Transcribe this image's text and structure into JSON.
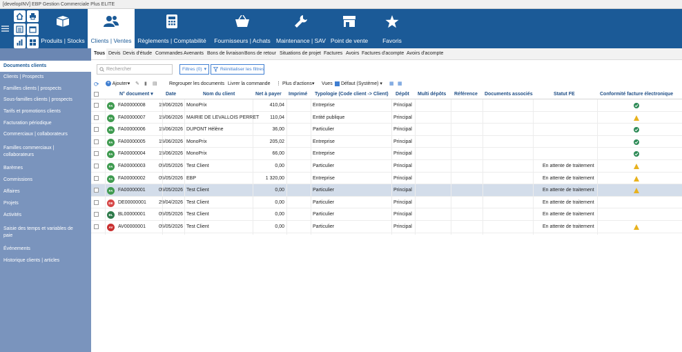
{
  "window_title": "[developINV] EBP Gestion Commerciale Plus ELITE",
  "ribbon": {
    "tabs": [
      {
        "label": "Produits | Stocks",
        "icon": "box-icon"
      },
      {
        "label": "Clients | Ventes",
        "icon": "users-icon",
        "active": true
      },
      {
        "label": "Règlements | Comptabilité",
        "icon": "calculator-icon"
      },
      {
        "label": "Fournisseurs | Achats",
        "icon": "basket-icon"
      },
      {
        "label": "Maintenance | SAV",
        "icon": "wrench-icon"
      },
      {
        "label": "Point de vente",
        "icon": "store-icon"
      },
      {
        "label": "Favoris",
        "icon": "star-icon"
      }
    ]
  },
  "subtabs": [
    "Tous",
    "Devis",
    "Devis d'étude",
    "Commandes",
    "Avenants",
    "Bons de livraison",
    "Bons de retour",
    "Situations de projet",
    "Factures",
    "Avoirs",
    "Factures d'acompte",
    "Avoirs d'acompte"
  ],
  "sidebar": {
    "items": [
      "Documents clients",
      "Clients | Prospects",
      "Familles clients | prospects",
      "Sous-familles clients | prospects",
      "Tarifs et promotions clients",
      "Facturation périodique",
      "Commerciaux | collaborateurs",
      "Familles commerciaux | collaborateurs",
      "Barèmes",
      "Commissions",
      "Affaires",
      "Projets",
      "Activités",
      "Saisie des temps et variables de paie",
      "Événements",
      "Historique clients | articles"
    ]
  },
  "filters": {
    "search_placeholder": "Rechercher",
    "filters_label": "Filtres (0)",
    "reset_label": "Réinitialiser les filtres"
  },
  "toolbar": {
    "add": "Ajouter",
    "group": "Regrouper les documents",
    "deliver": "Livrer la commande",
    "more": "Plus d'actions",
    "views": "Vues",
    "view_value": "Défaut (Système)"
  },
  "table": {
    "columns": [
      "N° document",
      "Date",
      "Nom du client",
      "Net à payer",
      "Imprimé",
      "Typologie (Code client -> Client)",
      "Dépôt",
      "Multi dépôts",
      "Référence",
      "Documents associés",
      "Statut FE",
      "Conformité facture électronique"
    ],
    "rows": [
      {
        "type": "FA",
        "doc": "FA00000008",
        "date": "19/06/2026",
        "client": "MonoPrix",
        "net": "410,04",
        "typo": "Entreprise",
        "depot": "Principal",
        "statut": "",
        "conf": "ok"
      },
      {
        "type": "FA",
        "doc": "FA00000007",
        "date": "15/06/2026",
        "client": "MAIRIE DE LEVALLOIS PERRET",
        "net": "110,04",
        "typo": "Entité publique",
        "depot": "Principal",
        "statut": "",
        "conf": "warn"
      },
      {
        "type": "FA",
        "doc": "FA00000006",
        "date": "15/06/2026",
        "client": "DUPONT Hélène",
        "net": "36,00",
        "typo": "Particulier",
        "depot": "Principal",
        "statut": "",
        "conf": "ok"
      },
      {
        "type": "FA",
        "doc": "FA00000005",
        "date": "15/06/2026",
        "client": "MonoPrix",
        "net": "205,02",
        "typo": "Entreprise",
        "depot": "Principal",
        "statut": "",
        "conf": "ok"
      },
      {
        "type": "FA",
        "doc": "FA00000004",
        "date": "15/06/2026",
        "client": "MonoPrix",
        "net": "66,00",
        "typo": "Entreprise",
        "depot": "Principal",
        "statut": "",
        "conf": "ok"
      },
      {
        "type": "FA",
        "doc": "FA00000003",
        "date": "05/05/2026",
        "client": "Test Client",
        "net": "0,00",
        "typo": "Particulier",
        "depot": "Principal",
        "statut": "En attente de traitement",
        "conf": "warn"
      },
      {
        "type": "FA",
        "doc": "FA00000002",
        "date": "05/05/2026",
        "client": "EBP",
        "net": "1 320,00",
        "typo": "Entreprise",
        "depot": "Principal",
        "statut": "En attente de traitement",
        "conf": "warn"
      },
      {
        "type": "FA",
        "doc": "FA00000001",
        "date": "05/05/2026",
        "client": "Test Client",
        "net": "0,00",
        "typo": "Particulier",
        "depot": "Principal",
        "statut": "En attente de traitement",
        "conf": "warn",
        "selected": true
      },
      {
        "type": "DE",
        "doc": "DE00000001",
        "date": "29/04/2026",
        "client": "Test Client",
        "net": "0,00",
        "typo": "Particulier",
        "depot": "Principal",
        "statut": "En attente de traitement",
        "conf": ""
      },
      {
        "type": "BL",
        "doc": "BL00000001",
        "date": "05/05/2026",
        "client": "Test Client",
        "net": "0,00",
        "typo": "Particulier",
        "depot": "Principal",
        "statut": "En attente de traitement",
        "conf": ""
      },
      {
        "type": "AV",
        "doc": "AV00000001",
        "date": "05/05/2026",
        "client": "Test Client",
        "net": "0,00",
        "typo": "Particulier",
        "depot": "Principal",
        "statut": "En attente de traitement",
        "conf": "warn"
      }
    ]
  },
  "colors": {
    "ribbon": "#1b5a97",
    "sidebar": "#7a94bd",
    "badge_FA": "#3e9a4f",
    "badge_DE": "#d64545",
    "badge_BL": "#2e7a4a",
    "badge_AV": "#c93030",
    "ok": "#2e8b57",
    "warn": "#e8b21f"
  }
}
